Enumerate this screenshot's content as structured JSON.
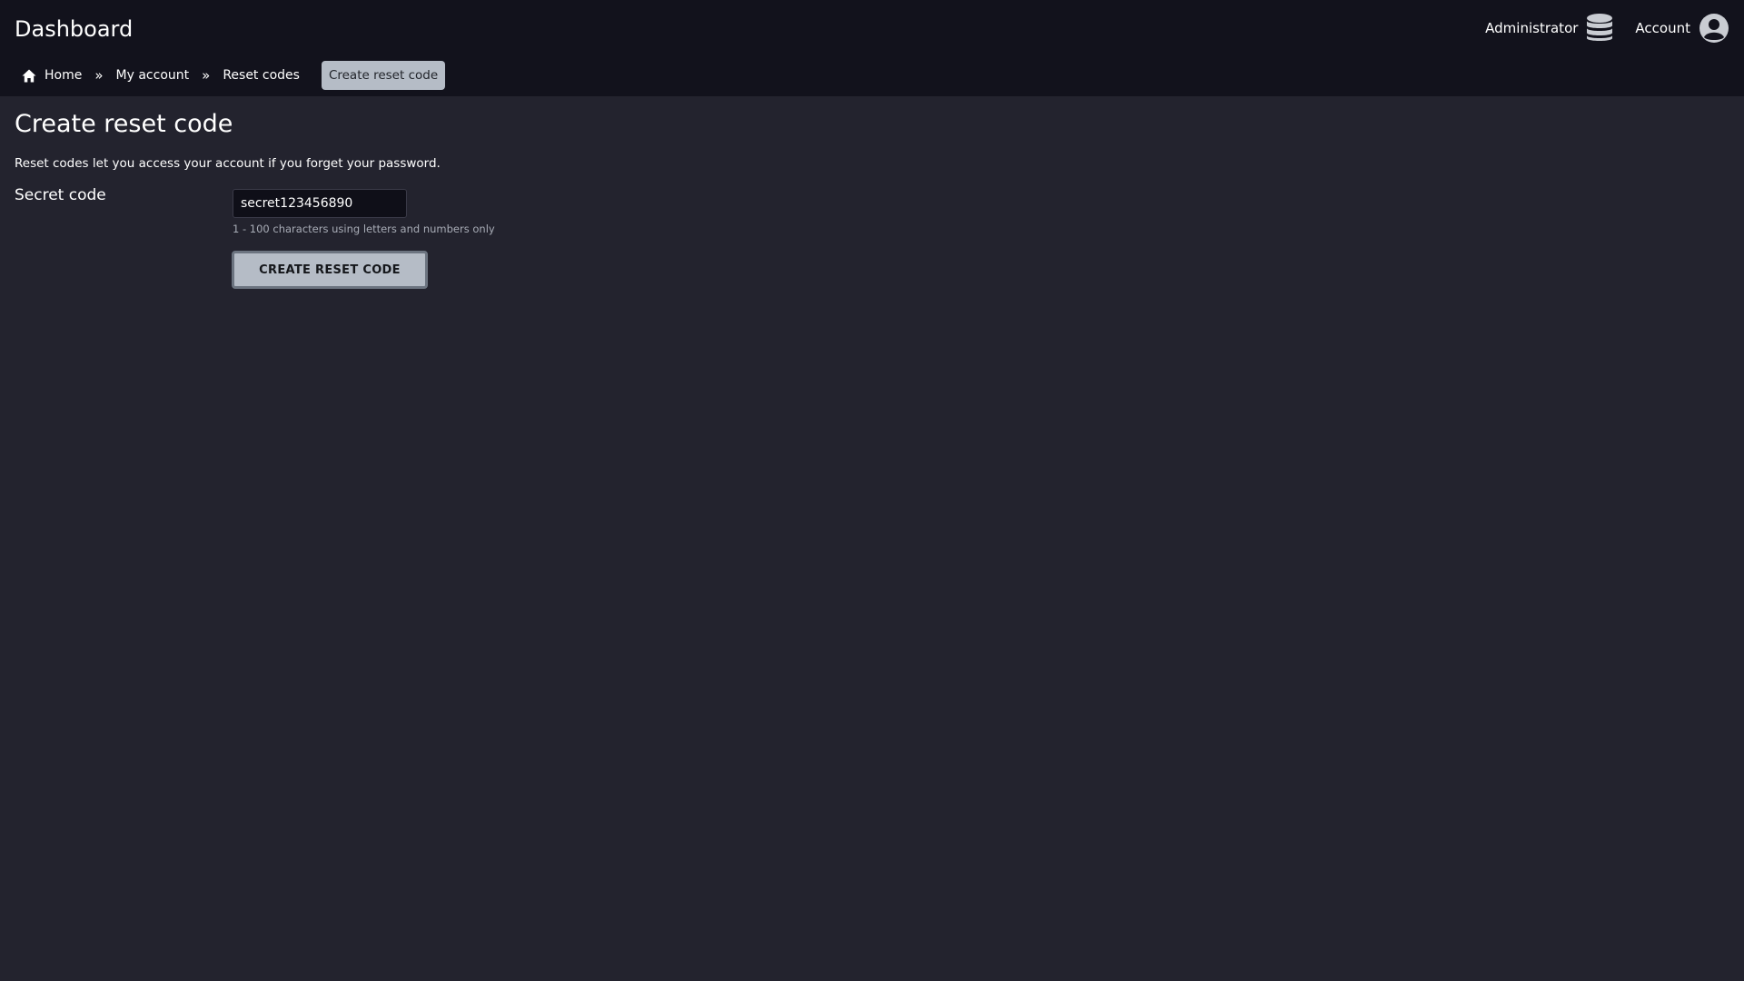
{
  "header": {
    "title": "Dashboard",
    "nav": [
      {
        "label": "Administrator",
        "icon": "database-icon"
      },
      {
        "label": "Account",
        "icon": "user-circle-icon"
      }
    ]
  },
  "breadcrumb": {
    "items": [
      {
        "label": "Home",
        "icon": "home-icon"
      },
      {
        "label": "My account"
      },
      {
        "label": "Reset codes"
      },
      {
        "label": "Create reset code",
        "active": true
      }
    ],
    "separator": "»"
  },
  "main": {
    "title": "Create reset code",
    "description": "Reset codes let you access your account if you forget your password.",
    "form": {
      "secret": {
        "label": "Secret code",
        "value": "secret123456890",
        "hint": "1 - 100 characters using letters and numbers only"
      },
      "submit_label": "CREATE RESET CODE"
    }
  },
  "colors": {
    "background": "#23232e",
    "header_bg": "#12121c",
    "accent_button": "#b5bcc6",
    "text": "#ffffff"
  }
}
